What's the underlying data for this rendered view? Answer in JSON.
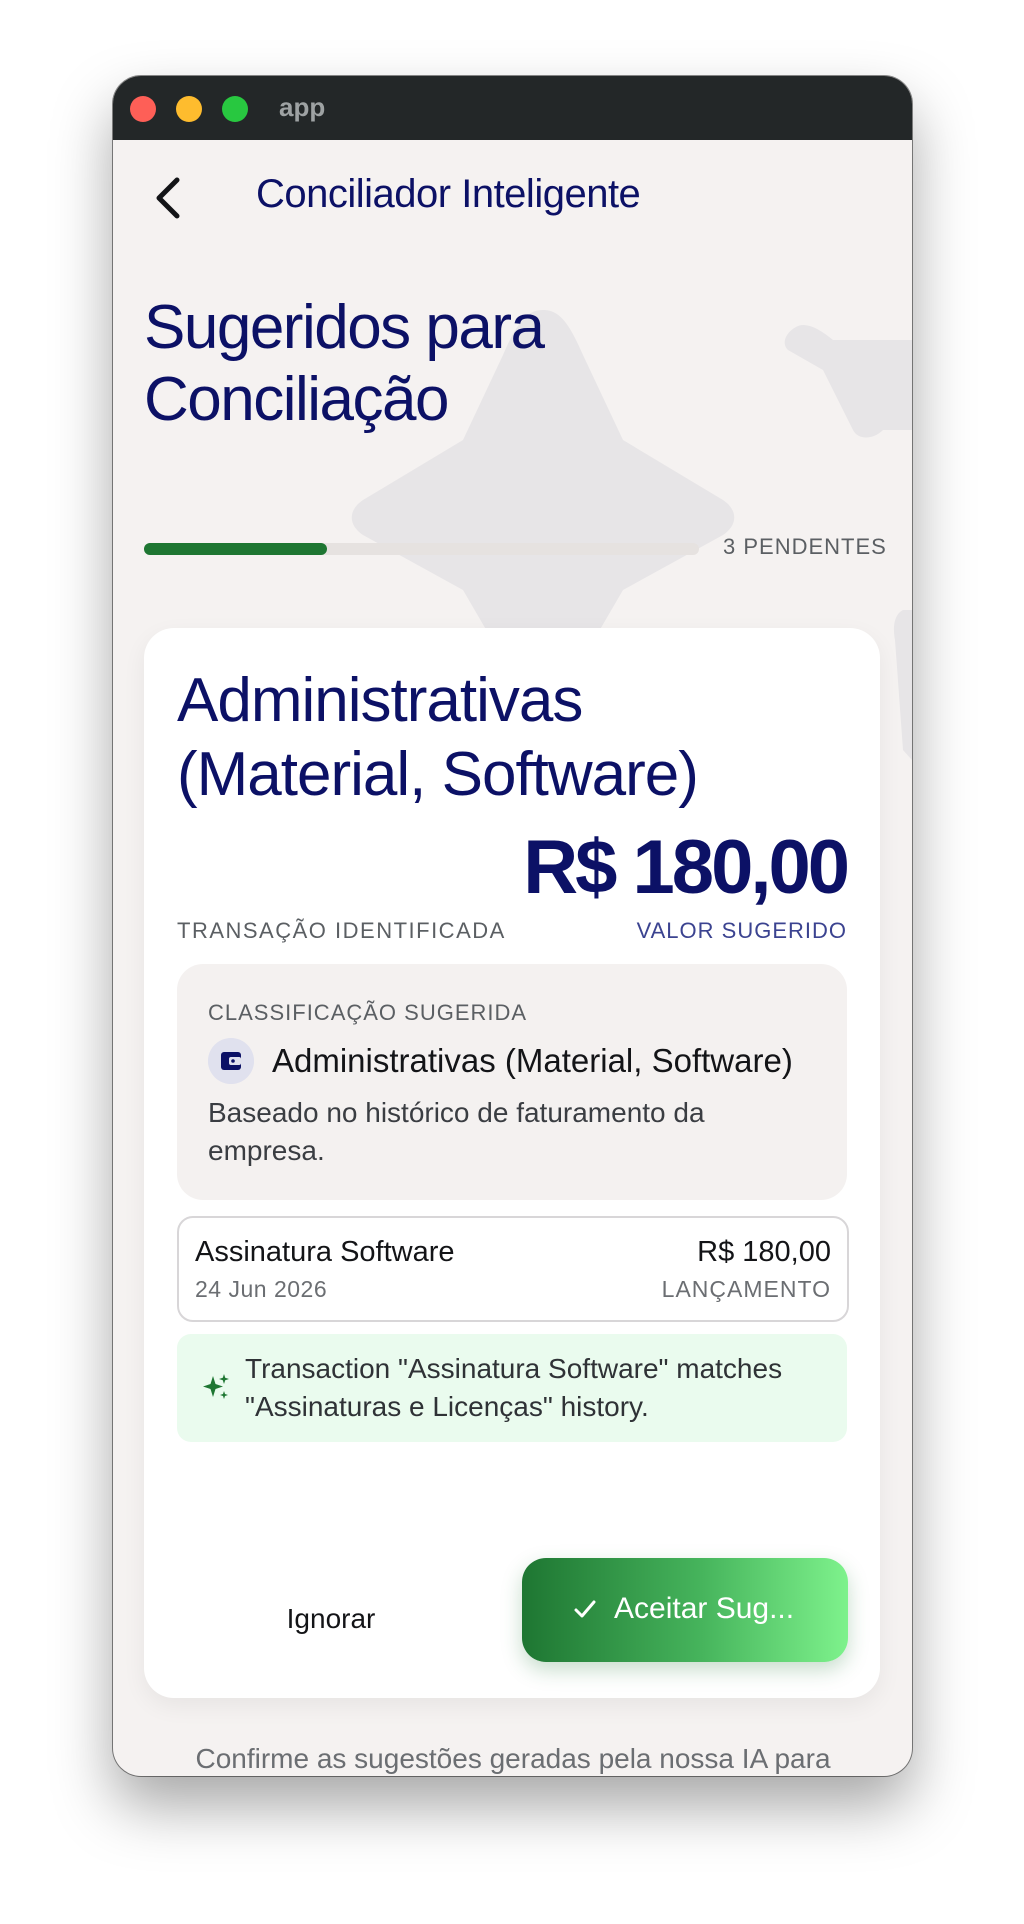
{
  "window": {
    "title": "app"
  },
  "header": {
    "title": "Conciliador Inteligente"
  },
  "section": {
    "title": "Sugeridos para Conciliação",
    "progress_fraction": 0.33,
    "pending_label": "3 PENDENTES"
  },
  "card": {
    "title": "Administrativas (Material, Software)",
    "amount": "R$ 180,00",
    "transaction_label": "TRANSAÇÃO IDENTIFICADA",
    "value_label": "VALOR SUGERIDO",
    "classification": {
      "heading": "CLASSIFICAÇÃO SUGERIDA",
      "name": "Administrativas (Material, Software)",
      "note": "Baseado no histórico de faturamento da empresa."
    },
    "transaction": {
      "name": "Assinatura Software",
      "date": "24 Jun 2026",
      "value": "R$ 180,00",
      "kind": "LANÇAMENTO"
    },
    "ai_note": "Transaction \"Assinatura Software\" matches \"Assinaturas e Licenças\" history.",
    "ignore_label": "Ignorar",
    "accept_label": "Aceitar Sug..."
  },
  "footer": {
    "text": "Confirme as sugestões geradas pela nossa IA para processar sua movimentação fiscal."
  },
  "colors": {
    "primary": "#0c1166",
    "accent_green": "#1e7632",
    "ai_bg": "#eafbee",
    "background": "#f5f2f1"
  },
  "icons": [
    "back-icon",
    "wallet-icon",
    "sparkle-icon",
    "check-icon"
  ]
}
